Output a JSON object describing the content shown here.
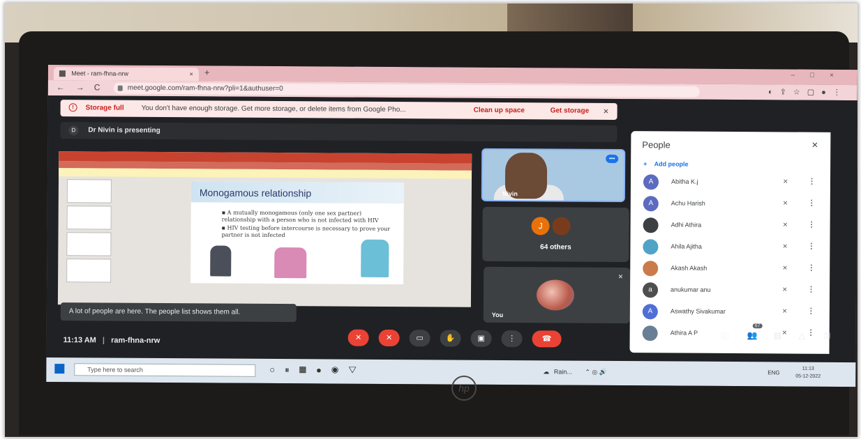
{
  "browser": {
    "tab_title": "Meet - ram-fhna-nrw",
    "tab_close": "×",
    "new_tab": "+",
    "url": "meet.google.com/ram-fhna-nrw?pli=1&authuser=0",
    "back": "←",
    "forward": "→",
    "reload": "C"
  },
  "banner": {
    "title": "Storage full",
    "message": "You don't have enough storage. Get more storage, or delete items from Google Pho...",
    "clean_up": "Clean up space",
    "get_storage": "Get storage",
    "close": "×"
  },
  "presenter": {
    "avatar_letter": "D",
    "text": "Dr Nivin is presenting"
  },
  "slide": {
    "title": "Monogamous relationship",
    "bullets": [
      "A mutually monogamous (only one sex partner) relationship with a person who is not infected with HIV",
      "HIV testing before intercourse is necessary to prove your partner is not infected"
    ]
  },
  "toast": "A lot of people are here. The people list shows them all.",
  "tiles": {
    "main_name": "Nivin",
    "others_label": "64 others",
    "others_avatar": "J",
    "you_label": "You"
  },
  "people_panel": {
    "title": "People",
    "close": "×",
    "add_people": "Add people",
    "participants": [
      {
        "name": "Abitha K.j",
        "initial": "A",
        "color": "#5c6bc0"
      },
      {
        "name": "Achu Harish",
        "initial": "A",
        "color": "#5c6bc0"
      },
      {
        "name": "Adhi Athira",
        "initial": "",
        "color": "#3c4043"
      },
      {
        "name": "Ahila Ajitha",
        "initial": "",
        "color": "#4fa3c7"
      },
      {
        "name": "Akash Akash",
        "initial": "",
        "color": "#c97b4a"
      },
      {
        "name": "anukumar anu",
        "initial": "a",
        "color": "#4e4e4e"
      },
      {
        "name": "Aswathy Sivakumar",
        "initial": "A",
        "color": "#4f6fd6"
      },
      {
        "name": "Athira A P",
        "initial": "",
        "color": "#6a7f95"
      }
    ]
  },
  "meeting": {
    "time": "11:13 AM",
    "separator": "|",
    "code": "ram-fhna-nrw",
    "participant_count": "67"
  },
  "taskbar": {
    "search_placeholder": "Type here to search",
    "weather": "Rain...",
    "lang": "ENG",
    "time": "11:13",
    "date": "05-12-2022"
  },
  "laptop_brand": "hp"
}
